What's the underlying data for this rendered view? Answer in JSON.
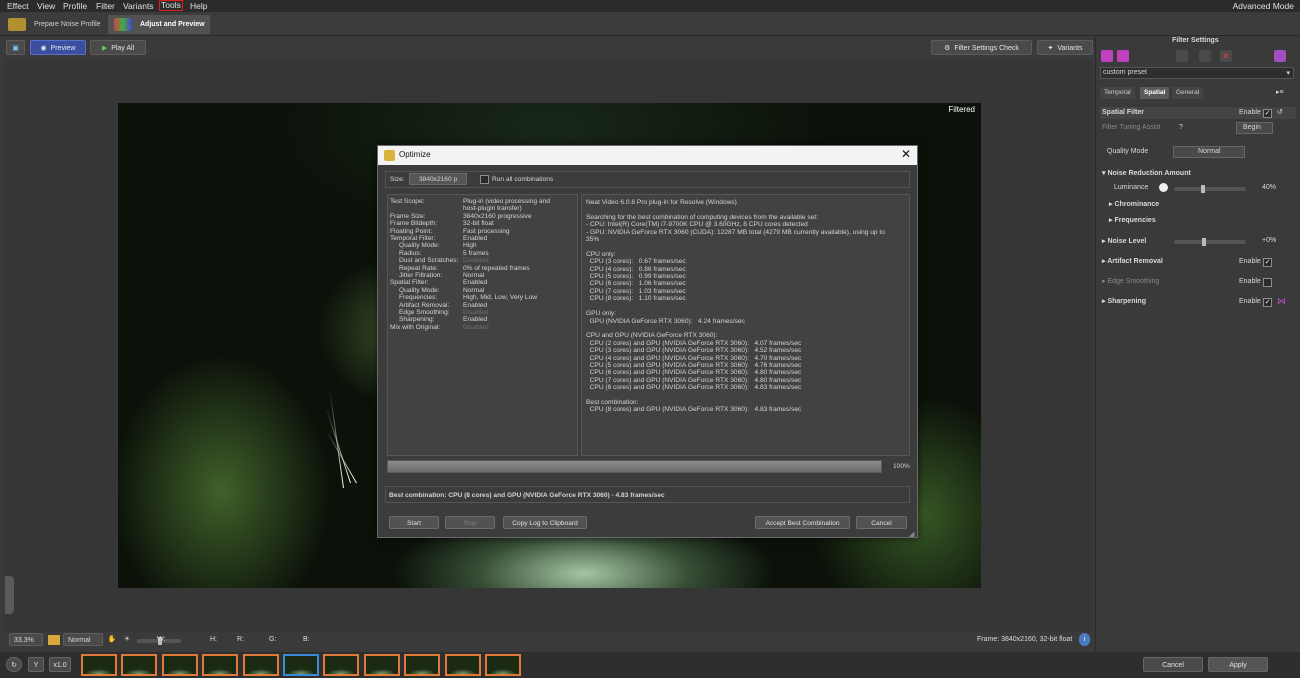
{
  "menubar": {
    "items": [
      "Effect",
      "View",
      "Profile",
      "Filter",
      "Variants",
      "Tools",
      "Help"
    ],
    "mode": "Advanced Mode"
  },
  "tabs": [
    "Prepare Noise Profile",
    "Adjust and Preview"
  ],
  "toolbar": {
    "preview": "Preview",
    "play_all": "Play All",
    "filter_settings_check": "Filter Settings Check",
    "variants": "Variants"
  },
  "viewer": {
    "label": "Filtered"
  },
  "infobar": {
    "zoom": "33.3%",
    "blend": "Normal",
    "w": "W:",
    "h": "H:",
    "r": "R:",
    "g": "G:",
    "b": "B:",
    "frame_info": "Frame: 3840x2160, 32-bit float"
  },
  "filmstrip": {
    "rate": "x1.0",
    "thumb_count": 11,
    "current_index": 5
  },
  "bottom_buttons": {
    "cancel": "Cancel",
    "apply": "Apply"
  },
  "right_panel": {
    "header": "Filter Settings",
    "preset": "custom preset",
    "tabs": [
      "Temporal",
      "Spatial",
      "General"
    ],
    "spatial_filter": "Spatial Filter",
    "enable": "Enable",
    "filter_tuning_assist": "Filter Tuning Assist",
    "begin": "Begin",
    "quality_mode_label": "Quality Mode",
    "quality_mode_value": "Normal",
    "noise_reduction_amount": "Noise Reduction Amount",
    "luminance": "Luminance",
    "luminance_value": "40%",
    "luminance_level": 0.4,
    "chrominance": "Chrominance",
    "frequencies": "Frequencies",
    "noise_level": "Noise Level",
    "noise_level_value": "+0%",
    "artifact_removal": "Artifact Removal",
    "edge_smoothing": "Edge Smoothing",
    "sharpening": "Sharpening"
  },
  "dialog": {
    "title": "Optimize",
    "size_label": "Size:",
    "size_value": "3840x2160 p",
    "run_all": "Run all combinations",
    "left_labels": [
      {
        "k": "Test Scope:",
        "v": "Plug-in (video processing and\nhost-plugin transfer)",
        "indent": 0
      },
      {
        "k": "Frame Size:",
        "v": "3840x2160 progressive",
        "indent": 0
      },
      {
        "k": "Frame Bitdepth:",
        "v": "32-bit float",
        "indent": 0
      },
      {
        "k": "Floating Point:",
        "v": "Fast processing",
        "indent": 0
      },
      {
        "k": "Temporal Filter:",
        "v": "Enabled",
        "indent": 0
      },
      {
        "k": "Quality Mode:",
        "v": "High",
        "indent": 1
      },
      {
        "k": "Radius:",
        "v": "5 frames",
        "indent": 1
      },
      {
        "k": "Dust and Scratches:",
        "v": "Disabled",
        "indent": 1,
        "dis": true
      },
      {
        "k": "Repeat Rate:",
        "v": "0% of repeated frames",
        "indent": 1
      },
      {
        "k": "Jitter Filtration:",
        "v": "Normal",
        "indent": 1
      },
      {
        "k": "Spatial Filter:",
        "v": "Enabled",
        "indent": 0
      },
      {
        "k": "Quality Mode:",
        "v": "Normal",
        "indent": 1
      },
      {
        "k": "Frequencies:",
        "v": "High, Mid, Low, Very Low",
        "indent": 1
      },
      {
        "k": "Artifact Removal:",
        "v": "Enabled",
        "indent": 1
      },
      {
        "k": "Edge Smoothing:",
        "v": "Disabled",
        "indent": 1,
        "dis": true
      },
      {
        "k": "Sharpening:",
        "v": "Enabled",
        "indent": 1
      },
      {
        "k": "Mix with Original:",
        "v": "Disabled",
        "indent": 0,
        "dis": true
      }
    ],
    "log": "Neat Video 6.0.6 Pro plug-in for Resolve (Windows)\n\nSearching for the best combination of computing devices from the available set:\n- CPU: Intel(R) Core(TM) i7-9700K CPU @ 3.60GHz, 8 CPU cores detected\n- GPU: NVIDIA GeForce RTX 3060 (CUDA): 12287 MB total (4279 MB currently available), using up to\n35%\n\nCPU only:\n  CPU (3 cores):   0.67 frames/sec\n  CPU (4 cores):   0.86 frames/sec\n  CPU (5 cores):   0.99 frames/sec\n  CPU (6 cores):   1.06 frames/sec\n  CPU (7 cores):   1.03 frames/sec\n  CPU (8 cores):   1.10 frames/sec\n\nGPU only:\n  GPU (NVIDIA GeForce RTX 3060):   4.24 frames/sec\n\nCPU and GPU (NVIDIA GeForce RTX 3060):\n  CPU (2 cores) and GPU (NVIDIA GeForce RTX 3060):   4.07 frames/sec\n  CPU (3 cores) and GPU (NVIDIA GeForce RTX 3060):   4.52 frames/sec\n  CPU (4 cores) and GPU (NVIDIA GeForce RTX 3060):   4.70 frames/sec\n  CPU (5 cores) and GPU (NVIDIA GeForce RTX 3060):   4.76 frames/sec\n  CPU (6 cores) and GPU (NVIDIA GeForce RTX 3060):   4.80 frames/sec\n  CPU (7 cores) and GPU (NVIDIA GeForce RTX 3060):   4.80 frames/sec\n  CPU (8 cores) and GPU (NVIDIA GeForce RTX 3060):   4.83 frames/sec\n\nBest combination:\n  CPU (8 cores) and GPU (NVIDIA GeForce RTX 3060):   4.83 frames/sec",
    "progress_pct": "100%",
    "progress_value": 1.0,
    "result": "Best combination: CPU (8 cores) and GPU (NVIDIA GeForce RTX 3060) - 4.83 frames/sec",
    "buttons": {
      "start": "Start",
      "stop": "Stop",
      "copy": "Copy Log to Clipboard",
      "accept": "Accept Best Combination",
      "cancel": "Cancel"
    }
  },
  "colors": {
    "accent_blue": "#3a4fa0",
    "menu_highlight": "#e02020",
    "thumb_border": "#e07a3a",
    "thumb_current": "#3a8ad8"
  }
}
